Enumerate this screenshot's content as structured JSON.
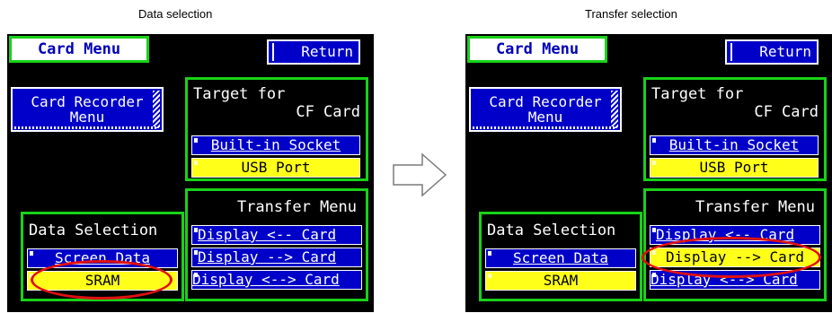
{
  "captions": {
    "left": "Data selection",
    "right": "Transfer selection"
  },
  "screens": [
    {
      "card_menu": "Card Menu",
      "return": "Return",
      "recorder_line1": "Card Recorder",
      "recorder_line2": "Menu",
      "target_title1": "Target for",
      "target_title2": "CF Card",
      "builtin": "Built-in Socket",
      "usb": "USB Port",
      "data_title": "Data Selection",
      "screen_data": "Screen Data",
      "sram": "SRAM",
      "transfer_title": "Transfer Menu",
      "t1": "Display <-- Card",
      "t2": "Display --> Card",
      "t3": "Display <--> Card"
    },
    {
      "card_menu": "Card Menu",
      "return": "Return",
      "recorder_line1": "Card Recorder",
      "recorder_line2": "Menu",
      "target_title1": "Target for",
      "target_title2": "CF Card",
      "builtin": "Built-in Socket",
      "usb": "USB Port",
      "data_title": "Data Selection",
      "screen_data": "Screen Data",
      "sram": "SRAM",
      "transfer_title": "Transfer Menu",
      "t1": "Display <-- Card",
      "t2": "Display --> Card",
      "t3": "Display <--> Card"
    }
  ],
  "colors": {
    "panel_border": "#19d119",
    "button_blue": "#0000c8",
    "selected_yellow": "#ffff1a",
    "highlight_ellipse": "#e01010"
  }
}
